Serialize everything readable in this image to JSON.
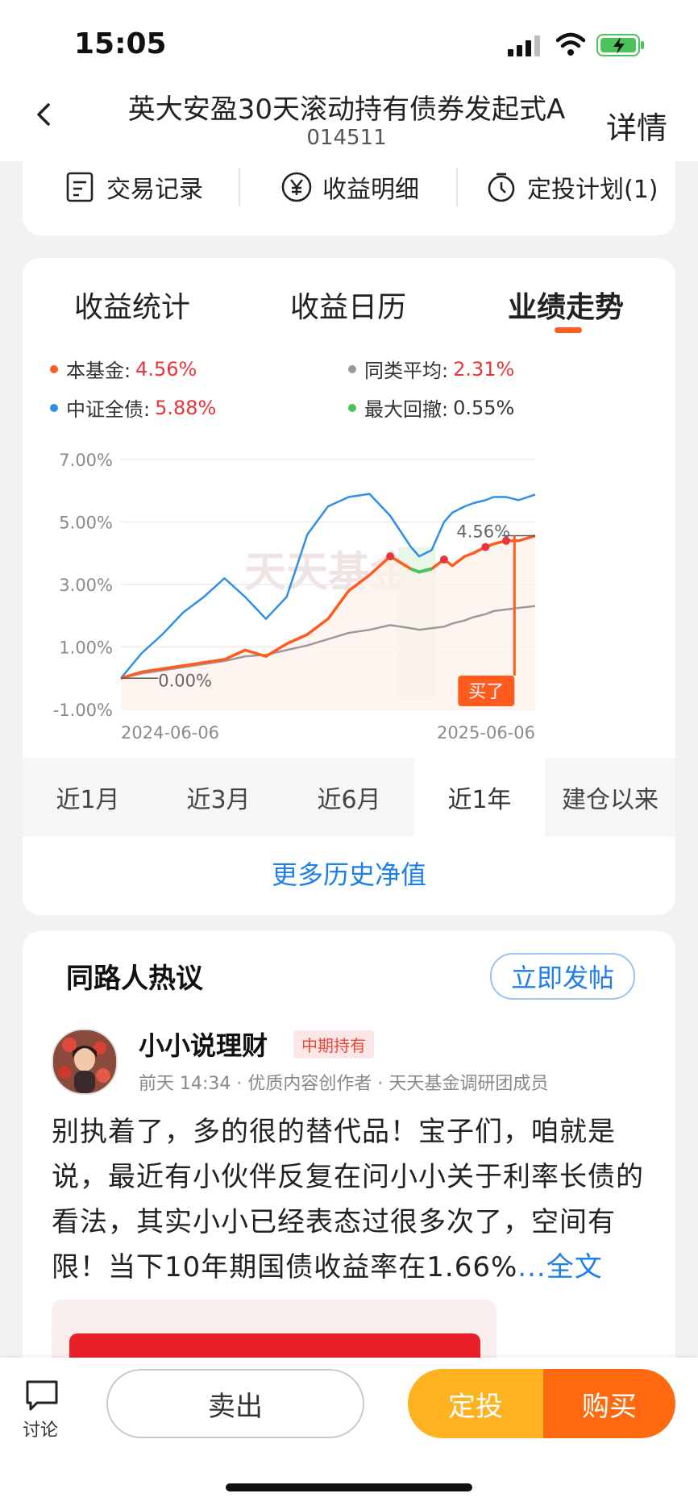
{
  "status": {
    "time": "15:05"
  },
  "header": {
    "title": "英大安盈30天滚动持有债券发起式A",
    "code": "014511",
    "detail": "详情"
  },
  "toolbar": [
    {
      "label": "交易记录",
      "icon": "document-icon"
    },
    {
      "label": "收益明细",
      "icon": "yen-circle-icon"
    },
    {
      "label": "定投计划(1)",
      "icon": "timer-icon"
    }
  ],
  "tabs": [
    "收益统计",
    "收益日历",
    "业绩走势"
  ],
  "active_tab": "业绩走势",
  "legend": [
    {
      "label": "本基金:",
      "value": "4.56%",
      "color": "#ff5a1f"
    },
    {
      "label": "同类平均:",
      "value": "2.31%",
      "color": "#999999"
    },
    {
      "label": "中证全债:",
      "value": "5.88%",
      "color": "#2e8ee8"
    },
    {
      "label": "最大回撤:",
      "value": "0.55%",
      "color": "#4cc35a"
    }
  ],
  "chart_data": {
    "type": "line",
    "y_ticks": [
      "7.00%",
      "5.00%",
      "3.00%",
      "1.00%",
      "-1.00%"
    ],
    "ylim": [
      -1,
      7
    ],
    "x_labels": [
      "2024-06-06",
      "2025-06-06"
    ],
    "watermark": "天天基金",
    "start_label": "0.00%",
    "end_label": "4.56%",
    "buy_label": "买了",
    "x": [
      0,
      0.05,
      0.1,
      0.15,
      0.2,
      0.25,
      0.3,
      0.35,
      0.4,
      0.45,
      0.5,
      0.55,
      0.6,
      0.65,
      0.7,
      0.72,
      0.75,
      0.78,
      0.8,
      0.83,
      0.85,
      0.88,
      0.9,
      0.93,
      0.96,
      1.0
    ],
    "series": [
      {
        "name": "本基金",
        "color": "#ff5a1f",
        "values": [
          0,
          0.2,
          0.3,
          0.4,
          0.5,
          0.6,
          0.9,
          0.7,
          1.1,
          1.4,
          1.9,
          2.8,
          3.3,
          3.9,
          3.5,
          3.4,
          3.5,
          3.8,
          3.6,
          3.9,
          4.0,
          4.2,
          4.3,
          4.4,
          4.4,
          4.56
        ]
      },
      {
        "name": "同类平均",
        "color": "#9a9a9a",
        "values": [
          0,
          0.15,
          0.25,
          0.35,
          0.45,
          0.55,
          0.7,
          0.75,
          0.9,
          1.05,
          1.25,
          1.45,
          1.55,
          1.7,
          1.6,
          1.55,
          1.6,
          1.65,
          1.75,
          1.85,
          1.95,
          2.05,
          2.15,
          2.2,
          2.25,
          2.31
        ]
      },
      {
        "name": "中证全债",
        "color": "#2e8ee8",
        "values": [
          0,
          0.8,
          1.4,
          2.1,
          2.6,
          3.2,
          2.6,
          1.9,
          2.6,
          4.6,
          5.5,
          5.8,
          5.9,
          5.2,
          4.2,
          3.9,
          4.1,
          5.0,
          5.3,
          5.5,
          5.6,
          5.7,
          5.8,
          5.8,
          5.7,
          5.88
        ]
      }
    ],
    "drawdown_range_x": [
      0.67,
      0.76
    ]
  },
  "periods": [
    "近1月",
    "近3月",
    "近6月",
    "近1年",
    "建仓以来"
  ],
  "active_period": "近1年",
  "more_history": "更多历史净值",
  "discussion": {
    "title": "同路人热议",
    "post_button": "立即发帖",
    "user": "小小说理财",
    "badge": "中期持有",
    "meta": "前天 14:34 · 优质内容创作者 · 天天基金调研团成员",
    "text": "别执着了，多的很的替代品！宝子们，咱就是说，最近有小伙伴反复在问小小关于利率长债的看法，其实小小已经表态过很多次了，空间有限！当下10年期国债收益率在1.66%",
    "read_more": "...全文"
  },
  "bottom": {
    "discuss": "讨论",
    "sell": "卖出",
    "dingtou": "定投",
    "buy": "购买"
  }
}
